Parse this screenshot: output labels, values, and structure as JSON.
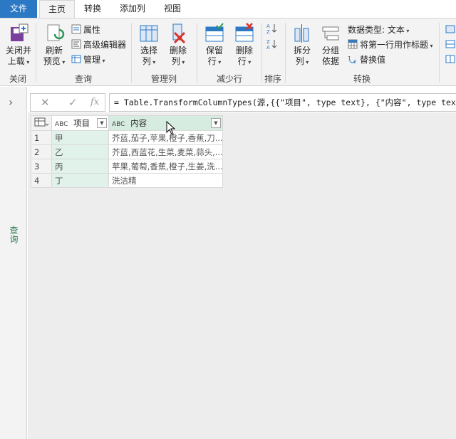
{
  "tabs": [
    {
      "label": "文件"
    },
    {
      "label": "主页"
    },
    {
      "label": "转换"
    },
    {
      "label": "添加列"
    },
    {
      "label": "视图"
    }
  ],
  "ribbon": {
    "close_group": {
      "btn_line1": "关闭并",
      "btn_line2": "上载",
      "label": "关闭"
    },
    "query_group": {
      "refresh_line1": "刷新",
      "refresh_line2": "预览",
      "properties": "属性",
      "advanced_editor": "高级编辑器",
      "manage": "管理",
      "label": "查询"
    },
    "manage_cols_group": {
      "choose_line1": "选择",
      "choose_line2": "列",
      "remove_line1": "删除",
      "remove_line2": "列",
      "label": "管理列"
    },
    "reduce_rows_group": {
      "keep_line1": "保留",
      "keep_line2": "行",
      "remove_line1": "删除",
      "remove_line2": "行",
      "label": "减少行"
    },
    "sort_group": {
      "label": "排序"
    },
    "transform_group": {
      "split_line1": "拆分",
      "split_line2": "列",
      "group_line1": "分组",
      "group_line2": "依据",
      "data_type": "数据类型: 文本",
      "first_row_header": "将第一行用作标题",
      "replace_values": "替换值",
      "label": "转换"
    }
  },
  "formula_bar": {
    "cancel_glyph": "✕",
    "confirm_glyph": "✓",
    "fx_label": "fx",
    "formula": "= Table.TransformColumnTypes(源,{{\"项目\", type text}, {\"内容\", type text}})"
  },
  "left_pane": {
    "label": "查询"
  },
  "table": {
    "type_badge": "ABC",
    "columns": [
      {
        "name": "项目"
      },
      {
        "name": "内容"
      }
    ],
    "rows": [
      {
        "num": "1",
        "a": "甲",
        "b": "芥蓝,茄子,苹果,橙子,香蕉,刀..."
      },
      {
        "num": "2",
        "a": "乙",
        "b": "芥蓝,西蓝花,生菜,麦菜,蒜头,..."
      },
      {
        "num": "3",
        "a": "丙",
        "b": "苹果,葡萄,香蕉,橙子,生姜,洗..."
      },
      {
        "num": "4",
        "a": "丁",
        "b": "洗洁精"
      }
    ]
  },
  "colors": {
    "file_tab": "#2b78c5",
    "selected_column": "#d6ece0",
    "query_label": "#2f7d4f"
  }
}
